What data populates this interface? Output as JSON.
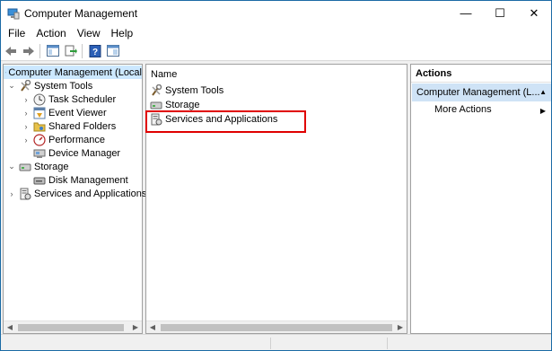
{
  "window": {
    "title": "Computer Management",
    "controls": {
      "minimize": "—",
      "maximize": "☐",
      "close": "✕"
    }
  },
  "menu": [
    "File",
    "Action",
    "View",
    "Help"
  ],
  "toolbar": {
    "buttons": [
      "back-icon",
      "forward-icon",
      "show-hide-tree-icon",
      "export-list-icon",
      "help-icon",
      "properties-icon"
    ]
  },
  "tree": {
    "root": "Computer Management (Local",
    "system_tools": "System Tools",
    "task_scheduler": "Task Scheduler",
    "event_viewer": "Event Viewer",
    "shared_folders": "Shared Folders",
    "performance": "Performance",
    "device_manager": "Device Manager",
    "storage": "Storage",
    "disk_management": "Disk Management",
    "services_and_applications": "Services and Applications"
  },
  "list": {
    "column_name": "Name",
    "items": [
      "System Tools",
      "Storage",
      "Services and Applications"
    ]
  },
  "actions": {
    "header": "Actions",
    "section": "Computer Management (L...",
    "more_actions": "More Actions"
  },
  "colors": {
    "selection": "#cce8ff",
    "actions_section": "#cfe3f6",
    "highlight": "#e00000"
  }
}
